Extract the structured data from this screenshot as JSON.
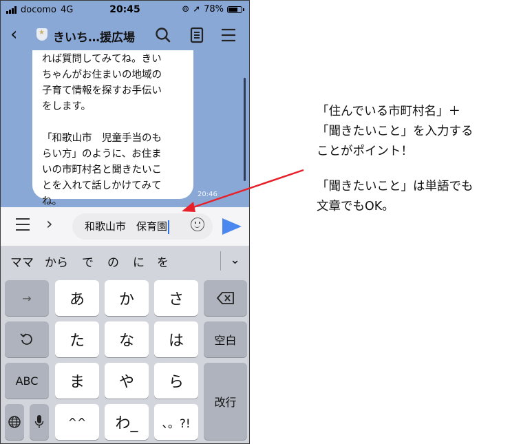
{
  "status_bar": {
    "carrier": "docomo",
    "network": "4G",
    "time": "20:45",
    "battery": "78%",
    "battery_level": 0.78
  },
  "header": {
    "title": "きいち…援広場"
  },
  "chat": {
    "message_lines": "れば質問してみてね。きい\nちゃんがお住まいの地域の\n子育て情報を探すお手伝い\nをします。\n\n「和歌山市　児童手当のも\nらい方」のように、お住ま\nいの市町村名と聞きたいこ\nとを入れて話しかけてみて\nね。",
    "message_time": "20:46"
  },
  "input": {
    "value": "和歌山市　保育園"
  },
  "keyboard": {
    "candidates": [
      "ママ",
      "から",
      "で",
      "の",
      "に",
      "を"
    ],
    "keys": {
      "arrow": "→",
      "a": "あ",
      "ka": "か",
      "sa": "さ",
      "ta": "た",
      "na": "な",
      "ha": "は",
      "space": "空白",
      "abc": "ABC",
      "ma": "ま",
      "ya": "や",
      "ra": "ら",
      "enter": "改行",
      "dakuten": "^^",
      "wa": "わ_",
      "punct": "、。?!"
    }
  },
  "annotation": {
    "line1": "「住んでいる市町村名」＋",
    "line2": "「聞きたいこと」を入力する",
    "line3": "ことがポイント！",
    "line4": "「聞きたいこと」は単語でも",
    "line5": "文章でもOK。",
    "arrow_color": "#e8202a"
  }
}
